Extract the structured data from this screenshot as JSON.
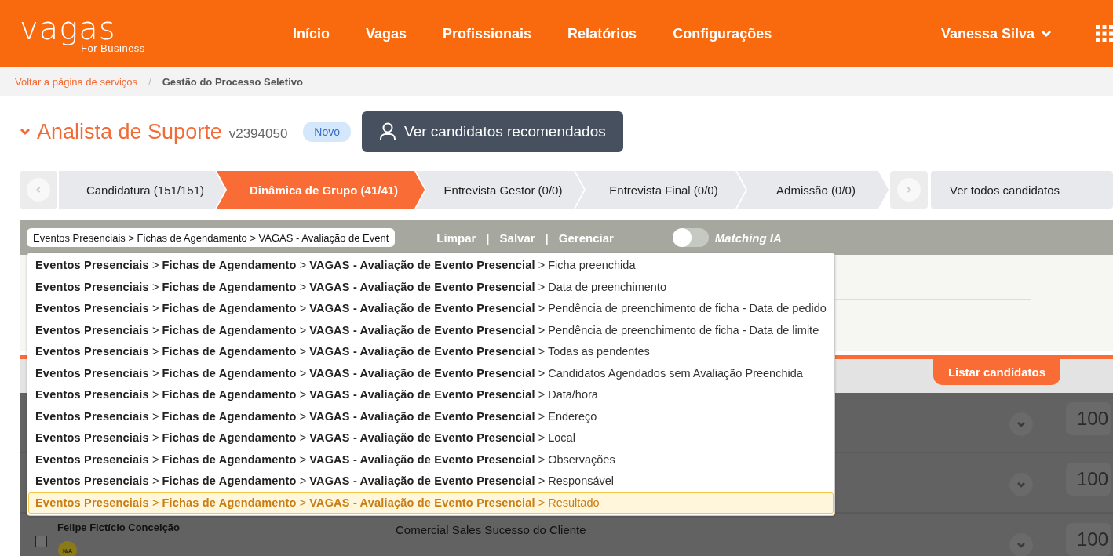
{
  "header": {
    "logo": "vagas",
    "logo_sub": "For Business",
    "nav": [
      {
        "label": "Início"
      },
      {
        "label": "Vagas"
      },
      {
        "label": "Profissionais"
      },
      {
        "label": "Relatórios"
      },
      {
        "label": "Configurações"
      }
    ],
    "user": "Vanessa Silva"
  },
  "breadcrumb": {
    "link": "Voltar a página de serviços",
    "separator": "/",
    "current": "Gestão do Processo Seletivo"
  },
  "job": {
    "title": "Analista de Suporte",
    "code": "v2394050",
    "badge": "Novo",
    "recommend_button": "Ver candidatos recomendados"
  },
  "stages": [
    {
      "label": "Candidatura (151/151)",
      "selected": false
    },
    {
      "label": "Dinâmica de Grupo (41/41)",
      "selected": true
    },
    {
      "label": "Entrevista Gestor (0/0)",
      "selected": false
    },
    {
      "label": "Entrevista Final (0/0)",
      "selected": false
    },
    {
      "label": "Admissão (0/0)",
      "selected": false
    }
  ],
  "all_candidates": "Ver todos candidatos",
  "filter": {
    "value": "Eventos Presenciais > Fichas de Agendamento > VAGAS - Avaliação de Event",
    "actions": [
      "Limpar",
      "Salvar",
      "Gerenciar"
    ],
    "separators": [
      "|",
      "|"
    ],
    "toggle": {
      "label": "Matching IA",
      "on": false
    }
  },
  "suggestions": [
    {
      "text": "**Eventos Presenciais** > **Fichas de Agendamento** > **VAGAS - Avaliação de Evento Presencial** > Ficha preenchida",
      "selected": false
    },
    {
      "text": "**Eventos Presenciais** > **Fichas de Agendamento** > **VAGAS - Avaliação de Evento Presencial** > Data de preenchimento",
      "selected": false
    },
    {
      "text": "**Eventos Presenciais** > **Fichas de Agendamento** > **VAGAS - Avaliação de Evento Presencial** > Pendência de preenchimento de ficha - Data de pedido",
      "selected": false
    },
    {
      "text": "**Eventos Presenciais** > **Fichas de Agendamento** > **VAGAS - Avaliação de Evento Presencial** > Pendência de preenchimento de ficha - Data de limite",
      "selected": false
    },
    {
      "text": "**Eventos Presenciais** > **Fichas de Agendamento** > **VAGAS - Avaliação de Evento Presencial** > Todas as pendentes",
      "selected": false
    },
    {
      "text": "**Eventos Presenciais** > **Fichas de Agendamento** > **VAGAS - Avaliação de Evento Presencial** > Candidatos Agendados sem Avaliação Preenchida",
      "selected": false
    },
    {
      "text": "**Eventos Presenciais** > **Fichas de Agendamento** > **VAGAS - Avaliação de Evento Presencial** > Data/hora",
      "selected": false
    },
    {
      "text": "**Eventos Presenciais** > **Fichas de Agendamento** > **VAGAS - Avaliação de Evento Presencial** > Endereço",
      "selected": false
    },
    {
      "text": "**Eventos Presenciais** > **Fichas de Agendamento** > **VAGAS - Avaliação de Evento Presencial** > Local",
      "selected": false
    },
    {
      "text": "**Eventos Presenciais** > **Fichas de Agendamento** > **VAGAS - Avaliação de Evento Presencial** > Observações",
      "selected": false
    },
    {
      "text": "**Eventos Presenciais** > **Fichas de Agendamento** > **VAGAS - Avaliação de Evento Presencial** > Responsável",
      "selected": false
    },
    {
      "text": "**Eventos Presenciais** > **Fichas de Agendamento** > **VAGAS - Avaliação de Evento Presencial** > Resultado",
      "selected": true
    }
  ],
  "list_button": "Listar candidatos",
  "candidates": [
    {
      "score": "100"
    },
    {
      "score": "100"
    },
    {
      "name": "Felipe Fictício Conceição",
      "badge": "N/A",
      "area": "Comercial Sales Sucesso do Cliente",
      "score": "100",
      "checked": false
    }
  ]
}
